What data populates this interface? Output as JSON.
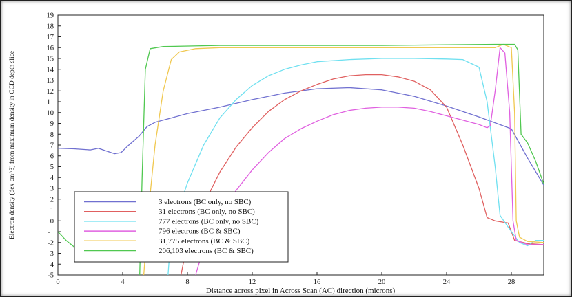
{
  "chart_data": {
    "type": "line",
    "title": "",
    "xlabel": "Distance across pixel in Across Scan (AC) direction (microns)",
    "ylabel": "Electron density (dex cm^3) from maximum density in CCD depth slice",
    "xlim": [
      0,
      30
    ],
    "ylim": [
      -5,
      19
    ],
    "xticks": [
      0,
      4,
      8,
      12,
      16,
      20,
      24,
      28
    ],
    "yticks": [
      -5,
      -4,
      -3,
      -2,
      -1,
      0,
      1,
      2,
      3,
      4,
      5,
      6,
      7,
      8,
      9,
      10,
      11,
      12,
      13,
      14,
      15,
      16,
      17,
      18,
      19
    ],
    "grid": false,
    "legend_position": "bottom-left",
    "series": [
      {
        "name": "3 electrons (BC only, no SBC)",
        "color": "#7070d0",
        "points": [
          [
            0,
            6.7
          ],
          [
            1,
            6.65
          ],
          [
            2,
            6.55
          ],
          [
            2.5,
            6.7
          ],
          [
            3,
            6.45
          ],
          [
            3.5,
            6.2
          ],
          [
            3.9,
            6.3
          ],
          [
            4.3,
            6.9
          ],
          [
            5,
            7.8
          ],
          [
            5.5,
            8.7
          ],
          [
            6,
            9.1
          ],
          [
            7,
            9.5
          ],
          [
            8,
            9.9
          ],
          [
            10,
            10.5
          ],
          [
            12,
            11.2
          ],
          [
            14,
            11.8
          ],
          [
            16,
            12.2
          ],
          [
            18,
            12.3
          ],
          [
            20,
            12.1
          ],
          [
            22,
            11.5
          ],
          [
            24,
            10.6
          ],
          [
            26,
            9.6
          ],
          [
            28,
            8.5
          ],
          [
            29,
            5.8
          ],
          [
            30,
            3.3
          ]
        ]
      },
      {
        "name": "31 electrons (BC only, no SBC)",
        "color": "#e06060",
        "points": [
          [
            7.6,
            -5
          ],
          [
            8,
            -2
          ],
          [
            9,
            1.5
          ],
          [
            10,
            4.5
          ],
          [
            11,
            6.8
          ],
          [
            12,
            8.6
          ],
          [
            13,
            10.1
          ],
          [
            14,
            11.2
          ],
          [
            15,
            12
          ],
          [
            16,
            12.6
          ],
          [
            17,
            13.1
          ],
          [
            18,
            13.4
          ],
          [
            19,
            13.5
          ],
          [
            20,
            13.5
          ],
          [
            21,
            13.3
          ],
          [
            22,
            12.9
          ],
          [
            23,
            12.1
          ],
          [
            24,
            10.5
          ],
          [
            25,
            7
          ],
          [
            26,
            3
          ],
          [
            26.5,
            0.3
          ],
          [
            27,
            0
          ],
          [
            27.8,
            -0.2
          ],
          [
            28.2,
            -1.8
          ],
          [
            29,
            -2.1
          ],
          [
            30,
            -2.2
          ]
        ]
      },
      {
        "name": "777 electrons (BC only, no SBC)",
        "color": "#6fe0f0",
        "points": [
          [
            6.8,
            -5
          ],
          [
            7,
            -1
          ],
          [
            8,
            3.5
          ],
          [
            9,
            7
          ],
          [
            10,
            9.5
          ],
          [
            11,
            11.2
          ],
          [
            12,
            12.5
          ],
          [
            13,
            13.4
          ],
          [
            14,
            14
          ],
          [
            15,
            14.4
          ],
          [
            16,
            14.7
          ],
          [
            18,
            14.9
          ],
          [
            20,
            15
          ],
          [
            22,
            15
          ],
          [
            24,
            14.95
          ],
          [
            25,
            14.9
          ],
          [
            26,
            14.2
          ],
          [
            26.5,
            11
          ],
          [
            27,
            5
          ],
          [
            27.3,
            0.5
          ],
          [
            28,
            -1
          ],
          [
            28.5,
            -2
          ],
          [
            29,
            -2.3
          ],
          [
            29.5,
            -1.8
          ],
          [
            30,
            -1.8
          ]
        ]
      },
      {
        "name": "796 electrons (BC & SBC)",
        "color": "#e060e0",
        "points": [
          [
            8.5,
            -5
          ],
          [
            9,
            -2.5
          ],
          [
            10,
            0.5
          ],
          [
            11,
            2.8
          ],
          [
            12,
            4.7
          ],
          [
            13,
            6.3
          ],
          [
            14,
            7.6
          ],
          [
            15,
            8.5
          ],
          [
            16,
            9.2
          ],
          [
            17,
            9.8
          ],
          [
            18,
            10.2
          ],
          [
            19,
            10.4
          ],
          [
            20,
            10.5
          ],
          [
            21,
            10.5
          ],
          [
            22,
            10.4
          ],
          [
            23,
            10.1
          ],
          [
            24,
            9.7
          ],
          [
            25,
            9.3
          ],
          [
            26,
            8.9
          ],
          [
            26.5,
            8.6
          ],
          [
            26.7,
            8.8
          ],
          [
            27,
            12
          ],
          [
            27.3,
            16
          ],
          [
            27.6,
            15.5
          ],
          [
            27.9,
            10
          ],
          [
            28.1,
            0
          ],
          [
            28.3,
            -1.8
          ],
          [
            29,
            -2.2
          ],
          [
            30,
            -2.2
          ]
        ]
      },
      {
        "name": "31,775 electrons (BC & SBC)",
        "color": "#f0c850",
        "points": [
          [
            5.3,
            -5
          ],
          [
            5.6,
            1
          ],
          [
            6,
            7
          ],
          [
            6.5,
            12
          ],
          [
            7,
            14.9
          ],
          [
            7.5,
            15.6
          ],
          [
            8.5,
            15.9
          ],
          [
            10,
            16
          ],
          [
            20,
            16
          ],
          [
            27,
            16
          ],
          [
            27.5,
            16.3
          ],
          [
            28,
            16
          ],
          [
            28.2,
            10
          ],
          [
            28.3,
            0
          ],
          [
            28.5,
            -1.5
          ],
          [
            29,
            -1.9
          ],
          [
            30,
            -2
          ]
        ]
      },
      {
        "name": "206,103 electrons (BC & SBC)",
        "color": "#50c850",
        "points": [
          [
            0,
            -1
          ],
          [
            0.5,
            -1.8
          ],
          [
            1,
            -2.4
          ],
          [
            1.2,
            -2.6
          ]
        ]
      },
      {
        "name": "206,103 electrons (BC & SBC)",
        "color": "#50c850",
        "points": [
          [
            5.05,
            -5
          ],
          [
            5.2,
            4
          ],
          [
            5.4,
            14
          ],
          [
            5.7,
            15.9
          ],
          [
            6.5,
            16.1
          ],
          [
            10,
            16.2
          ],
          [
            20,
            16.2
          ],
          [
            27,
            16.3
          ],
          [
            28.2,
            16.3
          ],
          [
            28.4,
            15.8
          ],
          [
            28.6,
            8
          ],
          [
            29,
            7.2
          ],
          [
            29.5,
            5.5
          ],
          [
            30,
            3.4
          ]
        ]
      }
    ]
  }
}
